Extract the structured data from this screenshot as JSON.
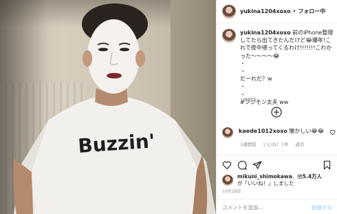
{
  "post": {
    "username": "yukina1204xoxo",
    "dot": "•",
    "follow_status": "フォロー中"
  },
  "caption": {
    "username": "yukina1204xoxo",
    "text": " 前のiPhone整理してたら出てきたんだけど😂爆年!これで夜中帰ってくるわけ!!!!!!!こわかった〜〜〜〜😂\n・\n・\nだーれだ？w\n・\n・\n#フジモン太夫 ww",
    "time": "1週間前"
  },
  "comment": {
    "username": "kaede1012xoxo",
    "text": " 懐かしい😂😂",
    "time": "1週間前",
    "likes": "いいね！1件",
    "reply": "返信"
  },
  "likes": {
    "username": "mikuni_shimokawa",
    "text_mid": "、他",
    "count": "5.4万人",
    "text_end": "が「いいね！」しました"
  },
  "post_date": "10月28日",
  "comment_box": {
    "placeholder": "コメントを追加...",
    "post_label": "投稿する"
  },
  "photo": {
    "shirt_text": "Buzzin'"
  },
  "colors": {
    "accent": "#0095f6",
    "muted": "#8e8e8e",
    "post_disabled": "#b2dffc"
  }
}
